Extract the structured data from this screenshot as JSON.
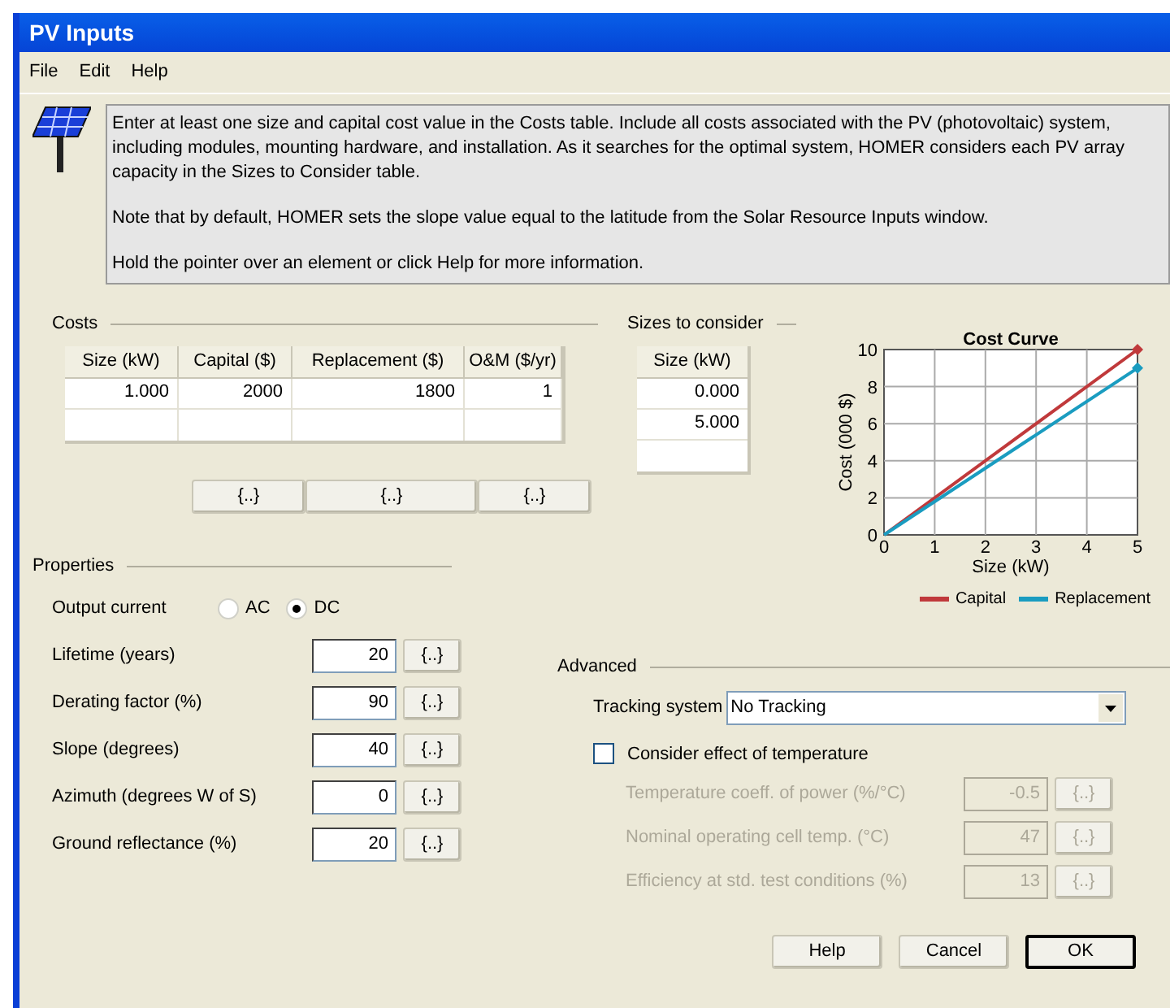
{
  "window": {
    "title": "PV Inputs"
  },
  "menu": [
    "File",
    "Edit",
    "Help"
  ],
  "info": [
    "Enter at least one size and capital cost value in the Costs table.  Include all costs associated with the PV (photovoltaic) system, including modules, mounting hardware, and installation. As it searches for the optimal system, HOMER considers each PV array capacity in the Sizes to Consider table.",
    "Note that by default, HOMER sets the slope value equal to the latitude from the Solar Resource Inputs window.",
    "Hold the pointer over an element or click Help for more information."
  ],
  "costs": {
    "title": "Costs",
    "columns": [
      "Size (kW)",
      "Capital ($)",
      "Replacement ($)",
      "O&M ($/yr)"
    ],
    "rows": [
      [
        "1.000",
        "2000",
        "1800",
        "1"
      ]
    ],
    "buttons": [
      "{..}",
      "{..}",
      "{..}"
    ]
  },
  "sizes": {
    "title": "Sizes to consider",
    "column": "Size (kW)",
    "rows": [
      "0.000",
      "5.000"
    ]
  },
  "chart": {
    "chart_data": {
      "type": "line",
      "title": "Cost Curve",
      "xlabel": "Size (kW)",
      "ylabel": "Cost (000 $)",
      "x": [
        0,
        5
      ],
      "series": [
        {
          "name": "Capital",
          "color": "#c0393b",
          "values": [
            0,
            10
          ]
        },
        {
          "name": "Replacement",
          "color": "#1a9cc0",
          "values": [
            0,
            9
          ]
        }
      ],
      "xlim": [
        0,
        5
      ],
      "ylim": [
        0,
        10
      ],
      "xticks": [
        {
          "value": 0,
          "label": "0"
        },
        {
          "value": 1,
          "label": "1"
        },
        {
          "value": 2,
          "label": "2"
        },
        {
          "value": 3,
          "label": "3"
        },
        {
          "value": 4,
          "label": "4"
        },
        {
          "value": 5,
          "label": "5"
        }
      ],
      "yticks": [
        {
          "value": 0,
          "label": "0"
        },
        {
          "value": 2,
          "label": "2"
        },
        {
          "value": 4,
          "label": "4"
        },
        {
          "value": 6,
          "label": "6"
        },
        {
          "value": 8,
          "label": "8"
        },
        {
          "value": 10,
          "label": "10"
        }
      ],
      "grid": true,
      "legend": true
    }
  },
  "properties": {
    "title": "Properties",
    "output_current": {
      "label": "Output current",
      "options": [
        {
          "label": "AC",
          "selected": false
        },
        {
          "label": "DC",
          "selected": true
        }
      ]
    },
    "fields": [
      {
        "label": "Lifetime (years)",
        "value": "20",
        "button": "{..}"
      },
      {
        "label": "Derating factor (%)",
        "value": "90",
        "button": "{..}"
      },
      {
        "label": "Slope (degrees)",
        "value": "40",
        "button": "{..}"
      },
      {
        "label": "Azimuth (degrees W of S)",
        "value": "0",
        "button": "{..}"
      },
      {
        "label": "Ground reflectance (%)",
        "value": "20",
        "button": "{..}"
      }
    ]
  },
  "advanced": {
    "title": "Advanced",
    "tracking": {
      "label": "Tracking system",
      "value": "No Tracking"
    },
    "temperature": {
      "label": "Consider effect of temperature",
      "checked": false
    },
    "fields": [
      {
        "label": "Temperature coeff. of power (%/°C)",
        "value": "-0.5",
        "button": "{..}",
        "disabled": true
      },
      {
        "label": "Nominal operating cell temp. (°C)",
        "value": "47",
        "button": "{..}",
        "disabled": true
      },
      {
        "label": "Efficiency at std. test conditions (%)",
        "value": "13",
        "button": "{..}",
        "disabled": true
      }
    ]
  },
  "buttons": [
    {
      "label": "Help",
      "default": false
    },
    {
      "label": "Cancel",
      "default": false
    },
    {
      "label": "OK",
      "default": true
    }
  ]
}
